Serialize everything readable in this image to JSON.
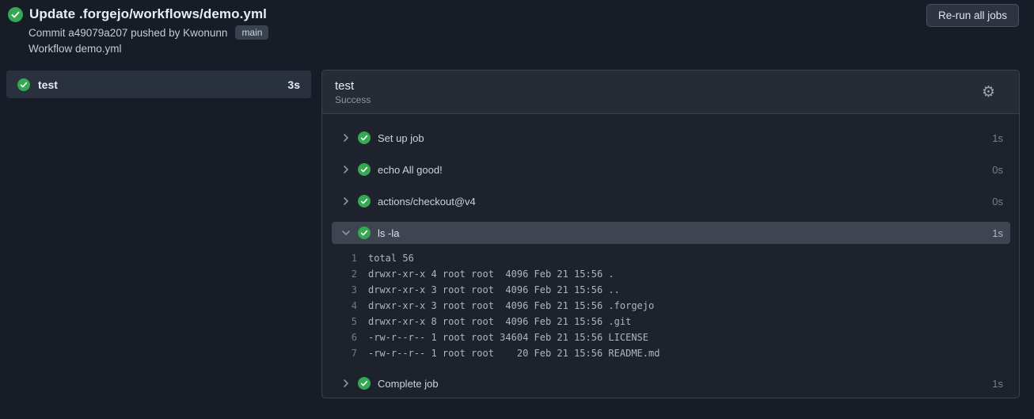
{
  "header": {
    "title": "Update .forgejo/workflows/demo.yml",
    "commit_prefix": "Commit a49079a207 pushed by Kwonunn",
    "branch": "main",
    "workflow_line": "Workflow demo.yml",
    "rerun_button": "Re-run all jobs"
  },
  "sidebar": {
    "jobs": [
      {
        "name": "test",
        "duration": "3s"
      }
    ]
  },
  "job_panel": {
    "title": "test",
    "status": "Success",
    "gear_icon": "⚙",
    "steps": [
      {
        "label": "Set up job",
        "duration": "1s"
      },
      {
        "label": "echo All good!",
        "duration": "0s"
      },
      {
        "label": "actions/checkout@v4",
        "duration": "0s"
      },
      {
        "label": "ls -la",
        "duration": "1s"
      },
      {
        "label": "Complete job",
        "duration": "1s"
      }
    ],
    "logs": [
      {
        "n": "1",
        "t": "total 56"
      },
      {
        "n": "2",
        "t": "drwxr-xr-x 4 root root  4096 Feb 21 15:56 ."
      },
      {
        "n": "3",
        "t": "drwxr-xr-x 3 root root  4096 Feb 21 15:56 .."
      },
      {
        "n": "4",
        "t": "drwxr-xr-x 3 root root  4096 Feb 21 15:56 .forgejo"
      },
      {
        "n": "5",
        "t": "drwxr-xr-x 8 root root  4096 Feb 21 15:56 .git"
      },
      {
        "n": "6",
        "t": "-rw-r--r-- 1 root root 34604 Feb 21 15:56 LICENSE"
      },
      {
        "n": "7",
        "t": "-rw-r--r-- 1 root root    20 Feb 21 15:56 README.md"
      }
    ]
  },
  "colors": {
    "page_bg": "#171c26",
    "panel_bg": "#1e222c",
    "panel_header_bg": "#262b36",
    "border": "#3a4150",
    "selected_row_bg": "#3e4450",
    "sidebar_item_bg": "#29303e",
    "success_green": "#34a853",
    "primary_text": "#e9edf3",
    "muted_text": "#768090"
  }
}
